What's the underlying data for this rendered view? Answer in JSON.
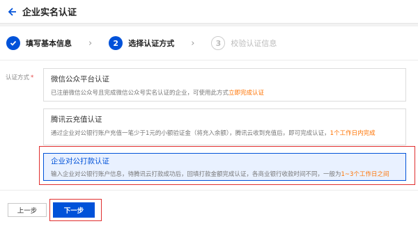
{
  "header": {
    "title": "企业实名认证"
  },
  "steps": [
    {
      "number": "",
      "label": "填写基本信息",
      "state": "done"
    },
    {
      "number": "2",
      "label": "选择认证方式",
      "state": "active"
    },
    {
      "number": "3",
      "label": "校验认证信息",
      "state": "todo"
    }
  ],
  "form": {
    "label": "认证方式",
    "required_mark": "*"
  },
  "options": [
    {
      "title": "微信公众平台认证",
      "desc": "已注册微信公众号且完成微信公众号实名认证的企业，可使用此方式",
      "highlight": "立即完成认证"
    },
    {
      "title": "腾讯云充值认证",
      "desc": "通过企业对公银行账户充值一笔少于1元的小额验证金（将充入余额），腾讯云收到充值后，即可完成认证，",
      "highlight": "1个工作日内完成"
    },
    {
      "title": "企业对公打款认证",
      "desc": "输入企业对公银行账户信息，待腾讯云打款成功后，回填打款金额完成认证，各商业银行收款时间不同，一般为",
      "highlight": "1~3个工作日之间",
      "selected": true
    }
  ],
  "buttons": {
    "prev": "上一步",
    "next": "下一步"
  },
  "colors": {
    "primary": "#0052d9",
    "highlight": "#ff7200",
    "annotation": "#e02e2e"
  }
}
